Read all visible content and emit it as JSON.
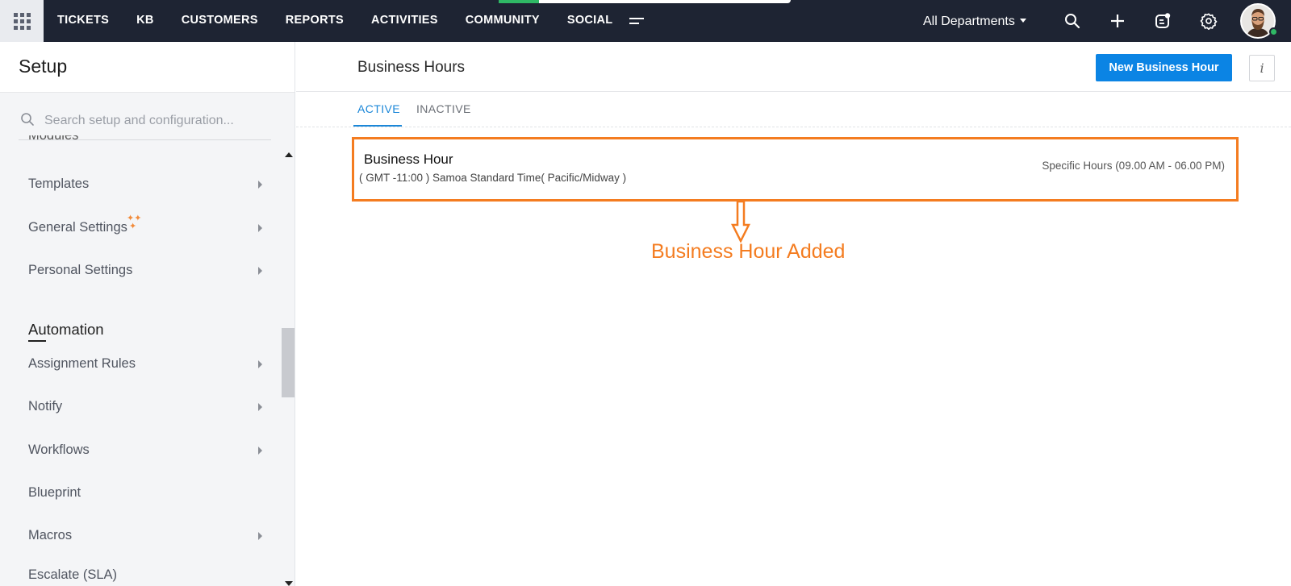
{
  "topbar": {
    "nav_items": [
      "TICKETS",
      "KB",
      "CUSTOMERS",
      "REPORTS",
      "ACTIVITIES",
      "COMMUNITY",
      "SOCIAL"
    ],
    "department": "All Departments"
  },
  "sidebar": {
    "title": "Setup",
    "search_placeholder": "Search setup and configuration...",
    "cutoff_top": "Modules",
    "items_top": [
      {
        "label": "Templates"
      },
      {
        "label": "General Settings"
      },
      {
        "label": "Personal Settings"
      }
    ],
    "section": "Automation",
    "automation_items": [
      {
        "label": "Assignment Rules"
      },
      {
        "label": "Notify"
      },
      {
        "label": "Workflows"
      },
      {
        "label": "Blueprint"
      },
      {
        "label": "Macros"
      },
      {
        "label": "Escalate (SLA)"
      }
    ]
  },
  "main": {
    "title": "Business Hours",
    "new_button": "New Business Hour",
    "info_button": "i",
    "tabs": [
      {
        "label": "ACTIVE",
        "active": true
      },
      {
        "label": "INACTIVE",
        "active": false
      }
    ],
    "business_hour": {
      "name": "Business Hour",
      "timezone": "( GMT -11:00 ) Samoa Standard Time( Pacific/Midway )",
      "hours": "Specific Hours (09.00 AM - 06.00 PM)"
    },
    "annotation": "Business Hour Added"
  },
  "colors": {
    "topbar": "#1e2433",
    "primary": "#0b84e4",
    "annotation": "#f47c20",
    "active_tab": "#1b87d8"
  }
}
